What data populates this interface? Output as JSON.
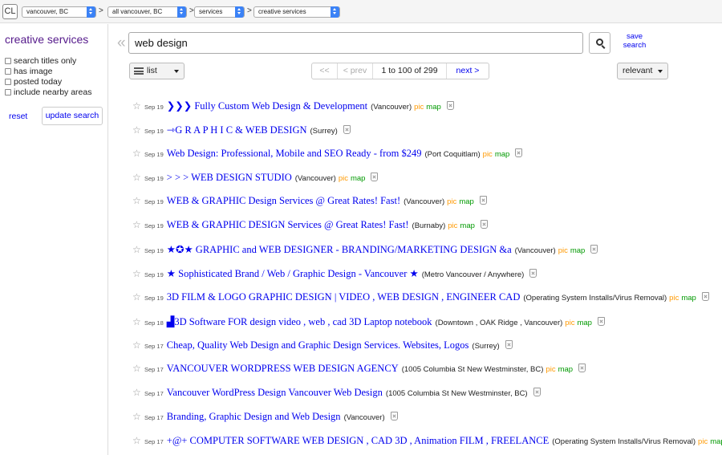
{
  "logo": "CL",
  "breadcrumbs": [
    {
      "label": "vancouver, BC"
    },
    {
      "label": "all vancouver, BC"
    },
    {
      "label": "services"
    },
    {
      "label": "creative services"
    }
  ],
  "breadcrumb_separator": ">",
  "sidebar": {
    "category_title": "creative services",
    "filters": [
      {
        "label": "search titles only",
        "checked": false
      },
      {
        "label": "has image",
        "checked": false
      },
      {
        "label": "posted today",
        "checked": false
      },
      {
        "label": "include nearby areas",
        "checked": false
      }
    ],
    "reset_label": "reset",
    "update_label": "update search"
  },
  "search": {
    "collapse_icon": "«",
    "query": "web design",
    "save_label_line1": "save",
    "save_label_line2": "search"
  },
  "toolbar": {
    "view_label": "list",
    "pager": {
      "first": "<<",
      "prev": "< prev",
      "range": "1 to 100 of 299",
      "next": "next >"
    },
    "sort_label": "relevant"
  },
  "colors": {
    "link": "#0000ee",
    "category": "#551a8b",
    "pic": "#ff9900",
    "map": "#009900"
  },
  "results": [
    {
      "date": "Sep 19",
      "title": "❯❯❯ Fully Custom Web Design & Development",
      "hood": "(Vancouver)",
      "pic": "pic",
      "map": "map"
    },
    {
      "date": "Sep 19",
      "title": "⇾G R A P H I C & WEB DESIGN",
      "hood": "(Surrey)",
      "pic": "",
      "map": ""
    },
    {
      "date": "Sep 19",
      "title": "Web Design: Professional, Mobile and SEO Ready - from $249",
      "hood": "(Port Coquitlam)",
      "pic": "pic",
      "map": "map"
    },
    {
      "date": "Sep 19",
      "title": "> > > WEB DESIGN STUDIO",
      "hood": "(Vancouver)",
      "pic": "pic",
      "map": "map"
    },
    {
      "date": "Sep 19",
      "title": "WEB & GRAPHIC Design Services @ Great Rates! Fast!",
      "hood": "(Vancouver)",
      "pic": "pic",
      "map": "map"
    },
    {
      "date": "Sep 19",
      "title": "WEB & GRAPHIC DESIGN Services @ Great Rates! Fast!",
      "hood": "(Burnaby)",
      "pic": "pic",
      "map": "map"
    },
    {
      "date": "Sep 19",
      "title": "★✪★ GRAPHIC and WEB DESIGNER - BRANDING/MARKETING DESIGN &a",
      "hood": "(Vancouver)",
      "pic": "pic",
      "map": "map"
    },
    {
      "date": "Sep 19",
      "title": "★ Sophisticated Brand / Web / Graphic Design - Vancouver ★",
      "hood": "(Metro Vancouver / Anywhere)",
      "pic": "",
      "map": ""
    },
    {
      "date": "Sep 19",
      "title": "3D FILM & LOGO GRAPHIC DESIGN | VIDEO , WEB DESIGN , ENGINEER CAD",
      "hood": "(Operating System Installs/Virus Removal)",
      "pic": "pic",
      "map": "map"
    },
    {
      "date": "Sep 18",
      "title": "▟3D Software FOR design video , web , cad 3D Laptop notebook",
      "hood": "(Downtown , OAK Ridge , Vancouver)",
      "pic": "pic",
      "map": "map"
    },
    {
      "date": "Sep 17",
      "title": "Cheap, Quality Web Design and Graphic Design Services. Websites, Logos",
      "hood": "(Surrey)",
      "pic": "",
      "map": ""
    },
    {
      "date": "Sep 17",
      "title": "VANCOUVER WORDPRESS WEB DESIGN AGENCY",
      "hood": "(1005 Columbia St New Westminster, BC)",
      "pic": "pic",
      "map": "map"
    },
    {
      "date": "Sep 17",
      "title": "Vancouver WordPress Design Vancouver Web Design",
      "hood": "(1005 Columbia St New Westminster, BC)",
      "pic": "",
      "map": ""
    },
    {
      "date": "Sep 17",
      "title": "Branding, Graphic Design and Web Design",
      "hood": "(Vancouver)",
      "pic": "",
      "map": ""
    },
    {
      "date": "Sep 17",
      "title": "+@+ COMPUTER SOFTWARE WEB DESIGN , CAD 3D , Animation FILM , FREELANCE",
      "hood": "(Operating System Installs/Virus Removal)",
      "pic": "pic",
      "map": "map"
    }
  ]
}
